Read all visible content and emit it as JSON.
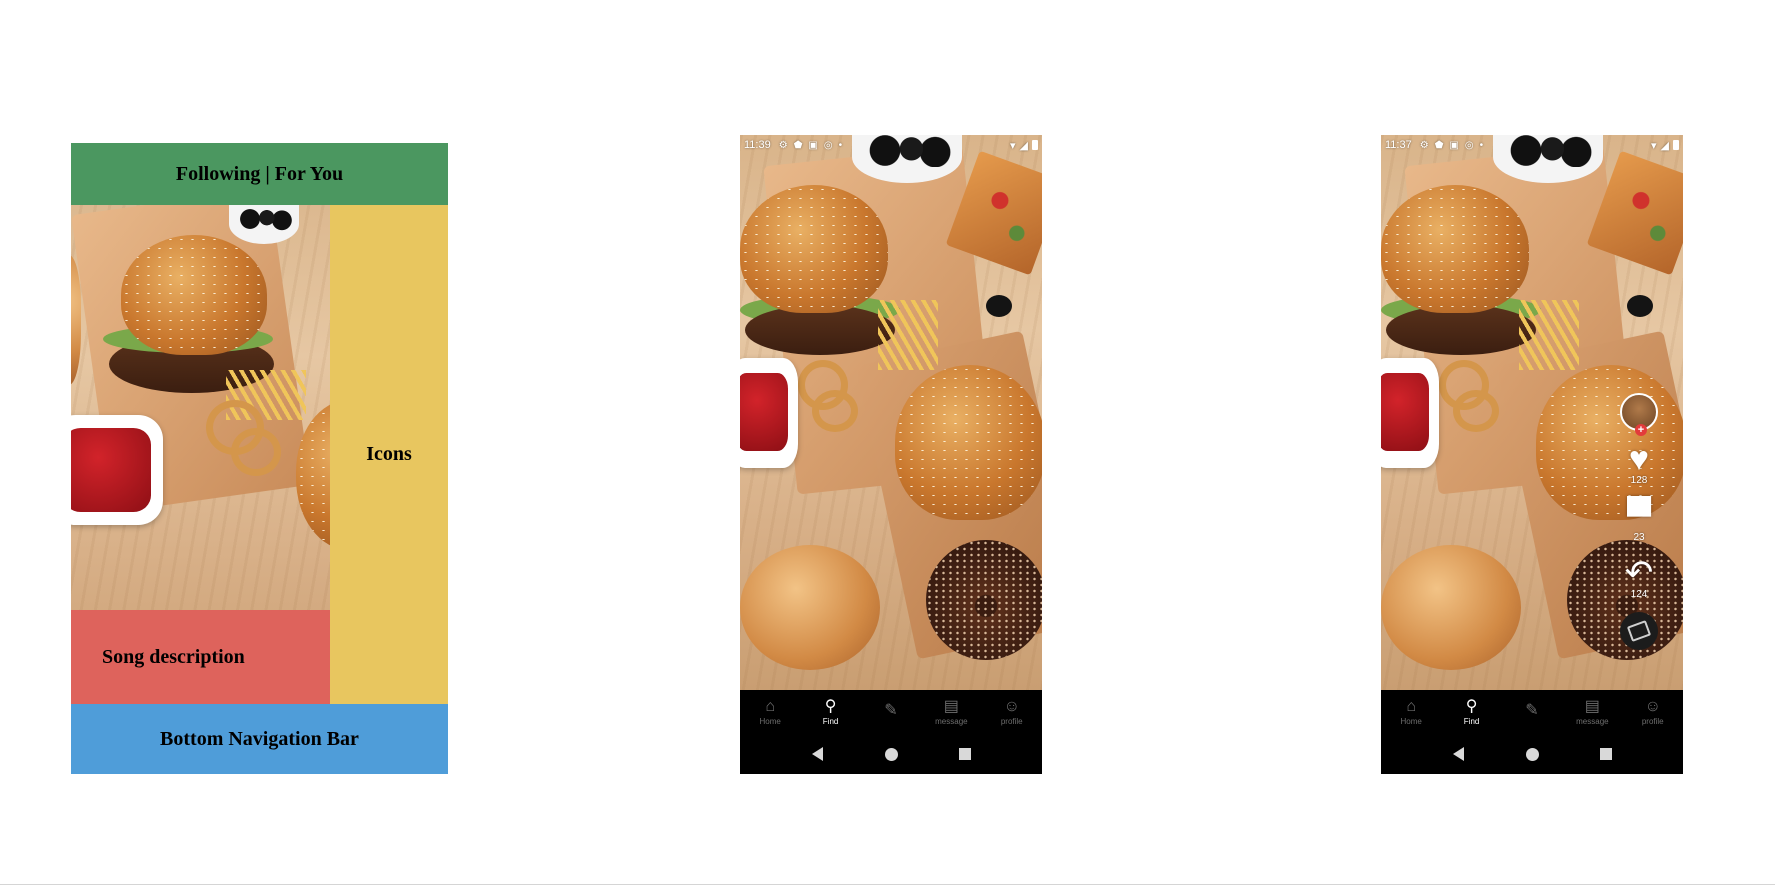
{
  "wireframe": {
    "header": "Following | For You",
    "icons": "Icons",
    "song": "Song description",
    "bottom": "Bottom Navigation Bar",
    "colors": {
      "header": "#4b9760",
      "icons": "#e8c65f",
      "song": "#de635c",
      "bottom": "#4f9dd9"
    }
  },
  "phone1": {
    "time": "11:39",
    "nav": [
      {
        "icon": "home-icon",
        "label": "Home"
      },
      {
        "icon": "search-icon",
        "label": "Find"
      },
      {
        "icon": "pencil-icon",
        "label": ""
      },
      {
        "icon": "message-icon",
        "label": "message"
      },
      {
        "icon": "profile-icon",
        "label": "profile"
      }
    ]
  },
  "phone2": {
    "time": "11:37",
    "likes": "128",
    "comments": "23",
    "shares": "124",
    "nav": [
      {
        "icon": "home-icon",
        "label": "Home"
      },
      {
        "icon": "search-icon",
        "label": "Find"
      },
      {
        "icon": "pencil-icon",
        "label": ""
      },
      {
        "icon": "message-icon",
        "label": "message"
      },
      {
        "icon": "profile-icon",
        "label": "profile"
      }
    ]
  }
}
